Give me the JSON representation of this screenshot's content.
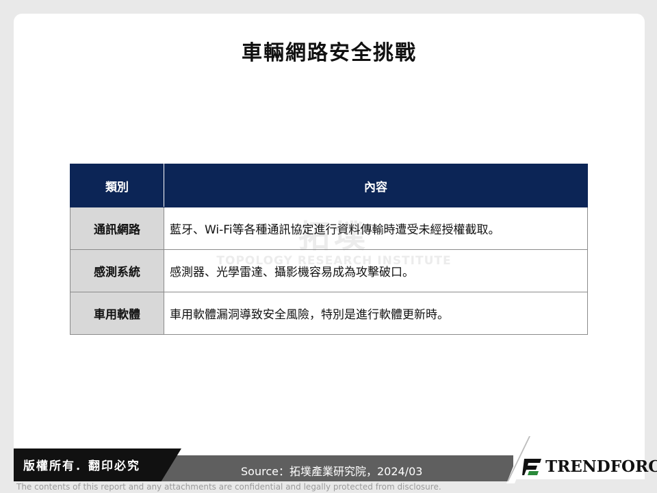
{
  "slide": {
    "title": "車輛網路安全挑戰"
  },
  "watermark": {
    "main": "拓墣",
    "sub": "TOPOLOGY RESEARCH INSTITUTE"
  },
  "table": {
    "headers": [
      "類別",
      "內容"
    ],
    "rows": [
      {
        "category": "通訊網路",
        "content": "藍牙、Wi-Fi等各種通訊協定進行資料傳輸時遭受未經授權截取。"
      },
      {
        "category": "感測系統",
        "content": "感測器、光學雷達、攝影機容易成為攻擊破口。"
      },
      {
        "category": "車用軟體",
        "content": "車用軟體漏洞導致安全風險，特別是進行軟體更新時。"
      }
    ]
  },
  "footer": {
    "copyright": "版權所有．翻印必究",
    "source": "Source：拓墣產業研究院，2024/03",
    "logo_text": "TRENDFORCE",
    "logo_icon": "trendforce-logo-icon",
    "disclaimer": "The contents of this report and any attachments are confidential and legally protected from disclosure."
  },
  "colors": {
    "header_bg": "#0c2556",
    "category_bg": "#d8d8d8",
    "footer_dark": "#111111",
    "footer_bar": "#5f5f5f"
  }
}
